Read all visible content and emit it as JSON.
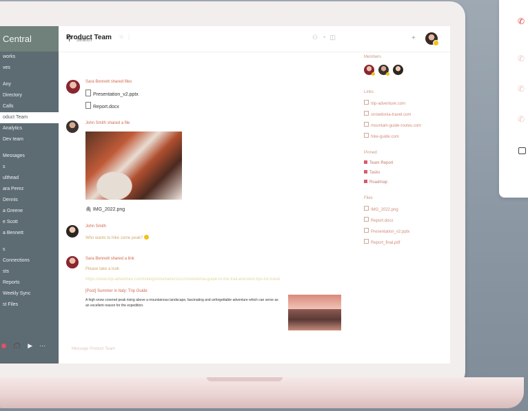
{
  "sidebar": {
    "title": "Central",
    "items": [
      {
        "label": "works",
        "active": false
      },
      {
        "label": "ves",
        "active": false
      },
      {
        "label": "",
        "active": false
      },
      {
        "label": "Any",
        "active": false
      },
      {
        "label": "Directory",
        "active": false
      },
      {
        "label": "Calls",
        "active": false
      },
      {
        "label": "oduct Team",
        "active": true
      },
      {
        "label": "Analytics",
        "active": false
      },
      {
        "label": "Dev team",
        "active": false
      },
      {
        "label": "",
        "active": false
      },
      {
        "label": "Messages",
        "active": false
      },
      {
        "label": "s",
        "active": false
      },
      {
        "label": "ulthead",
        "active": false
      },
      {
        "label": "ara Perez",
        "active": false
      },
      {
        "label": "Dennis",
        "active": false
      },
      {
        "label": "a Greene",
        "active": false
      },
      {
        "label": "e Scott",
        "active": false
      },
      {
        "label": "a Bennett",
        "active": false
      },
      {
        "label": "",
        "active": false
      },
      {
        "label": "s",
        "active": false
      },
      {
        "label": "Connections",
        "active": false
      },
      {
        "label": "sts",
        "active": false
      },
      {
        "label": "Reports",
        "active": false
      },
      {
        "label": "Weekly Sync",
        "active": false
      },
      {
        "label": "st Files",
        "active": false
      }
    ]
  },
  "search": {
    "placeholder": "Search"
  },
  "channel": {
    "title": "Product Team"
  },
  "messages": [
    {
      "author": "Sara Bennett shared files",
      "files": [
        "Presentation_v2.pptx",
        "Report.docx"
      ]
    },
    {
      "author": "John Smith shared a file",
      "image_name": "IMG_2022.png"
    },
    {
      "author": "John Smith",
      "text": "Who wants to hike some peak?"
    },
    {
      "author": "Sara Bennett shared a link",
      "text": "Please take a look",
      "link": "https://www.trip-adventure.com/hiking/mountains/2022/snowdonia-guide-to-the-trail-and-best-tips-for-travel",
      "preview_title": "[Post] Summer in Italy: Trip Guide",
      "preview_body": "A high snow covered peak rising above a mountainous landscape, fascinating and unforgettable adventure which can serve as an excellent reason for the expedition."
    }
  ],
  "reply_placeholder": "Message Product Team",
  "right_panel": {
    "members_label": "Members",
    "links_label": "Links",
    "links": [
      "trip-adventure.com",
      "snowdonia-travel.com",
      "mountain-guide-routes.com",
      "hike-guide.com"
    ],
    "pinned_label": "Pinned",
    "pinned": [
      "Team Report",
      "Tasks",
      "Roadmap"
    ],
    "files_label": "Files",
    "files": [
      "IMG_2022.png",
      "Report.docx",
      "Presentation_v2.pptx",
      "Report_final.pdf"
    ]
  }
}
